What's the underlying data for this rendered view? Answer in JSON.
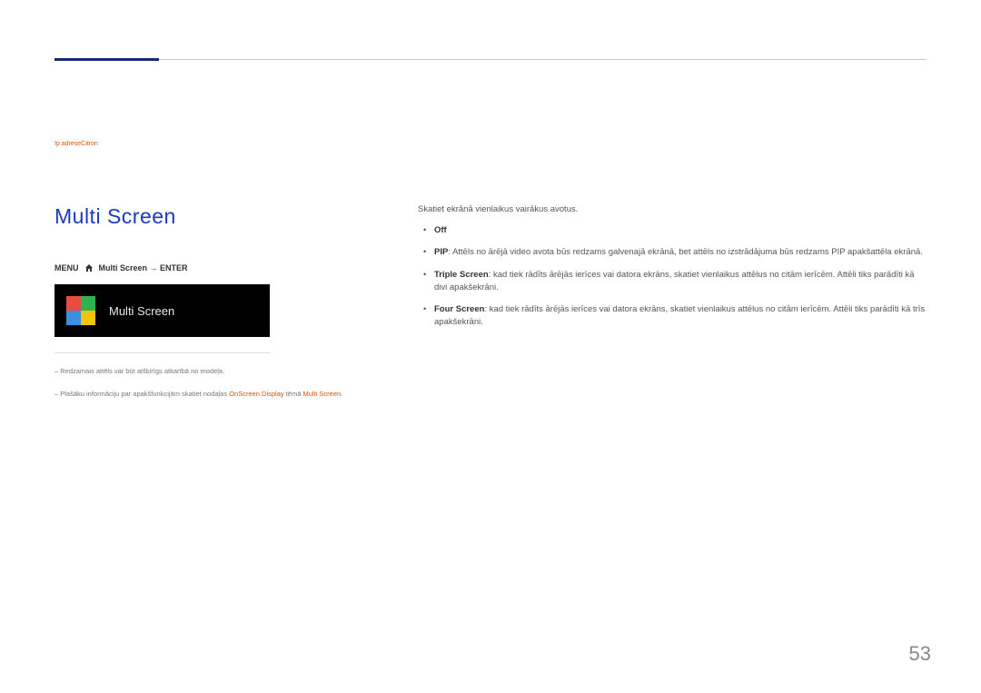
{
  "subtitle": {
    "prefix": "",
    "orange": "Ip adreseCitron"
  },
  "heading": "Multi Screen",
  "menu_path": {
    "left": "MENU",
    "right": "Multi Screen → ENTER"
  },
  "screenshot_label": "Multi Screen",
  "notes": {
    "n1": "– Redzamais attēls var būt atšķirīgs atkarībā no modeļa.",
    "n2_prefix": "– Plašāku informāciju par apakšfunkcijām skatiet nodaļas ",
    "n2_orange1": "OnScreen Display",
    "n2_mid": " tēmā ",
    "n2_orange2": "Multi Screen",
    "n2_suffix": "."
  },
  "intro": "Skatiet ekrānā vienlaikus vairākus avotus.",
  "bullets": [
    {
      "lead": "Off",
      "text": ""
    },
    {
      "lead": "PIP",
      "text": ": Attēls no ārējā video avota būs redzams galvenajā ekrānā, bet attēls no izstrādājuma būs redzams PIP apakšattēla ekrānā."
    },
    {
      "lead": "Triple Screen",
      "text": ": kad tiek rādīts ārējās ierīces vai datora ekrāns, skatiet vienlaikus attēlus no citām ierīcēm. Attēli tiks parādīti kā divi apakšekrāni."
    },
    {
      "lead": "Four Screen",
      "text": ": kad tiek rādīts ārējās ierīces vai datora ekrāns, skatiet vienlaikus attēlus no citām ierīcēm. Attēli tiks parādīti kā trīs apakšekrāni."
    }
  ],
  "page_number": "53"
}
